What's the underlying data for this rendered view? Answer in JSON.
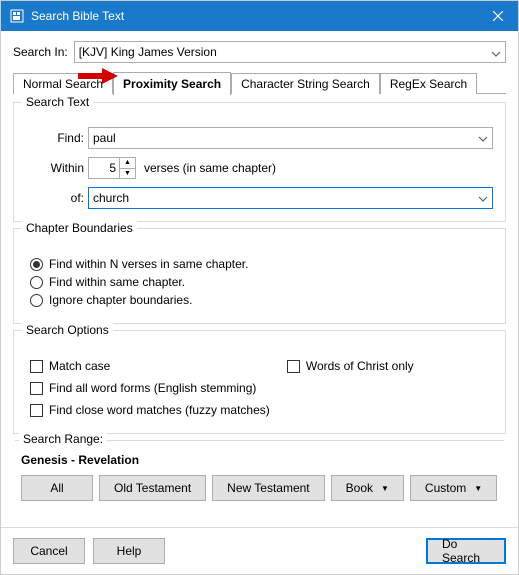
{
  "window": {
    "title": "Search Bible Text"
  },
  "searchIn": {
    "label": "Search In:",
    "value": "[KJV] King James Version"
  },
  "tabs": {
    "normal": "Normal Search",
    "proximity": "Proximity Search",
    "charstring": "Character String Search",
    "regex": "RegEx Search"
  },
  "searchText": {
    "legend": "Search Text",
    "findLabel": "Find:",
    "findValue": "paul",
    "withinLabel": "Within",
    "withinValue": "5",
    "withinSuffix": "verses (in same chapter)",
    "ofLabel": "of:",
    "ofValue": "church"
  },
  "boundaries": {
    "legend": "Chapter Boundaries",
    "opt1": "Find within N verses in same chapter.",
    "opt2": "Find within same chapter.",
    "opt3": "Ignore chapter boundaries."
  },
  "options": {
    "legend": "Search Options",
    "matchCase": "Match case",
    "wordsOfChrist": "Words of Christ only",
    "wordForms": "Find all word forms (English stemming)",
    "fuzzy": "Find close word matches (fuzzy matches)"
  },
  "range": {
    "legend": "Search Range:",
    "current": "Genesis - Revelation",
    "all": "All",
    "ot": "Old Testament",
    "nt": "New Testament",
    "book": "Book",
    "custom": "Custom"
  },
  "buttons": {
    "cancel": "Cancel",
    "help": "Help",
    "doSearch": "Do Search"
  }
}
